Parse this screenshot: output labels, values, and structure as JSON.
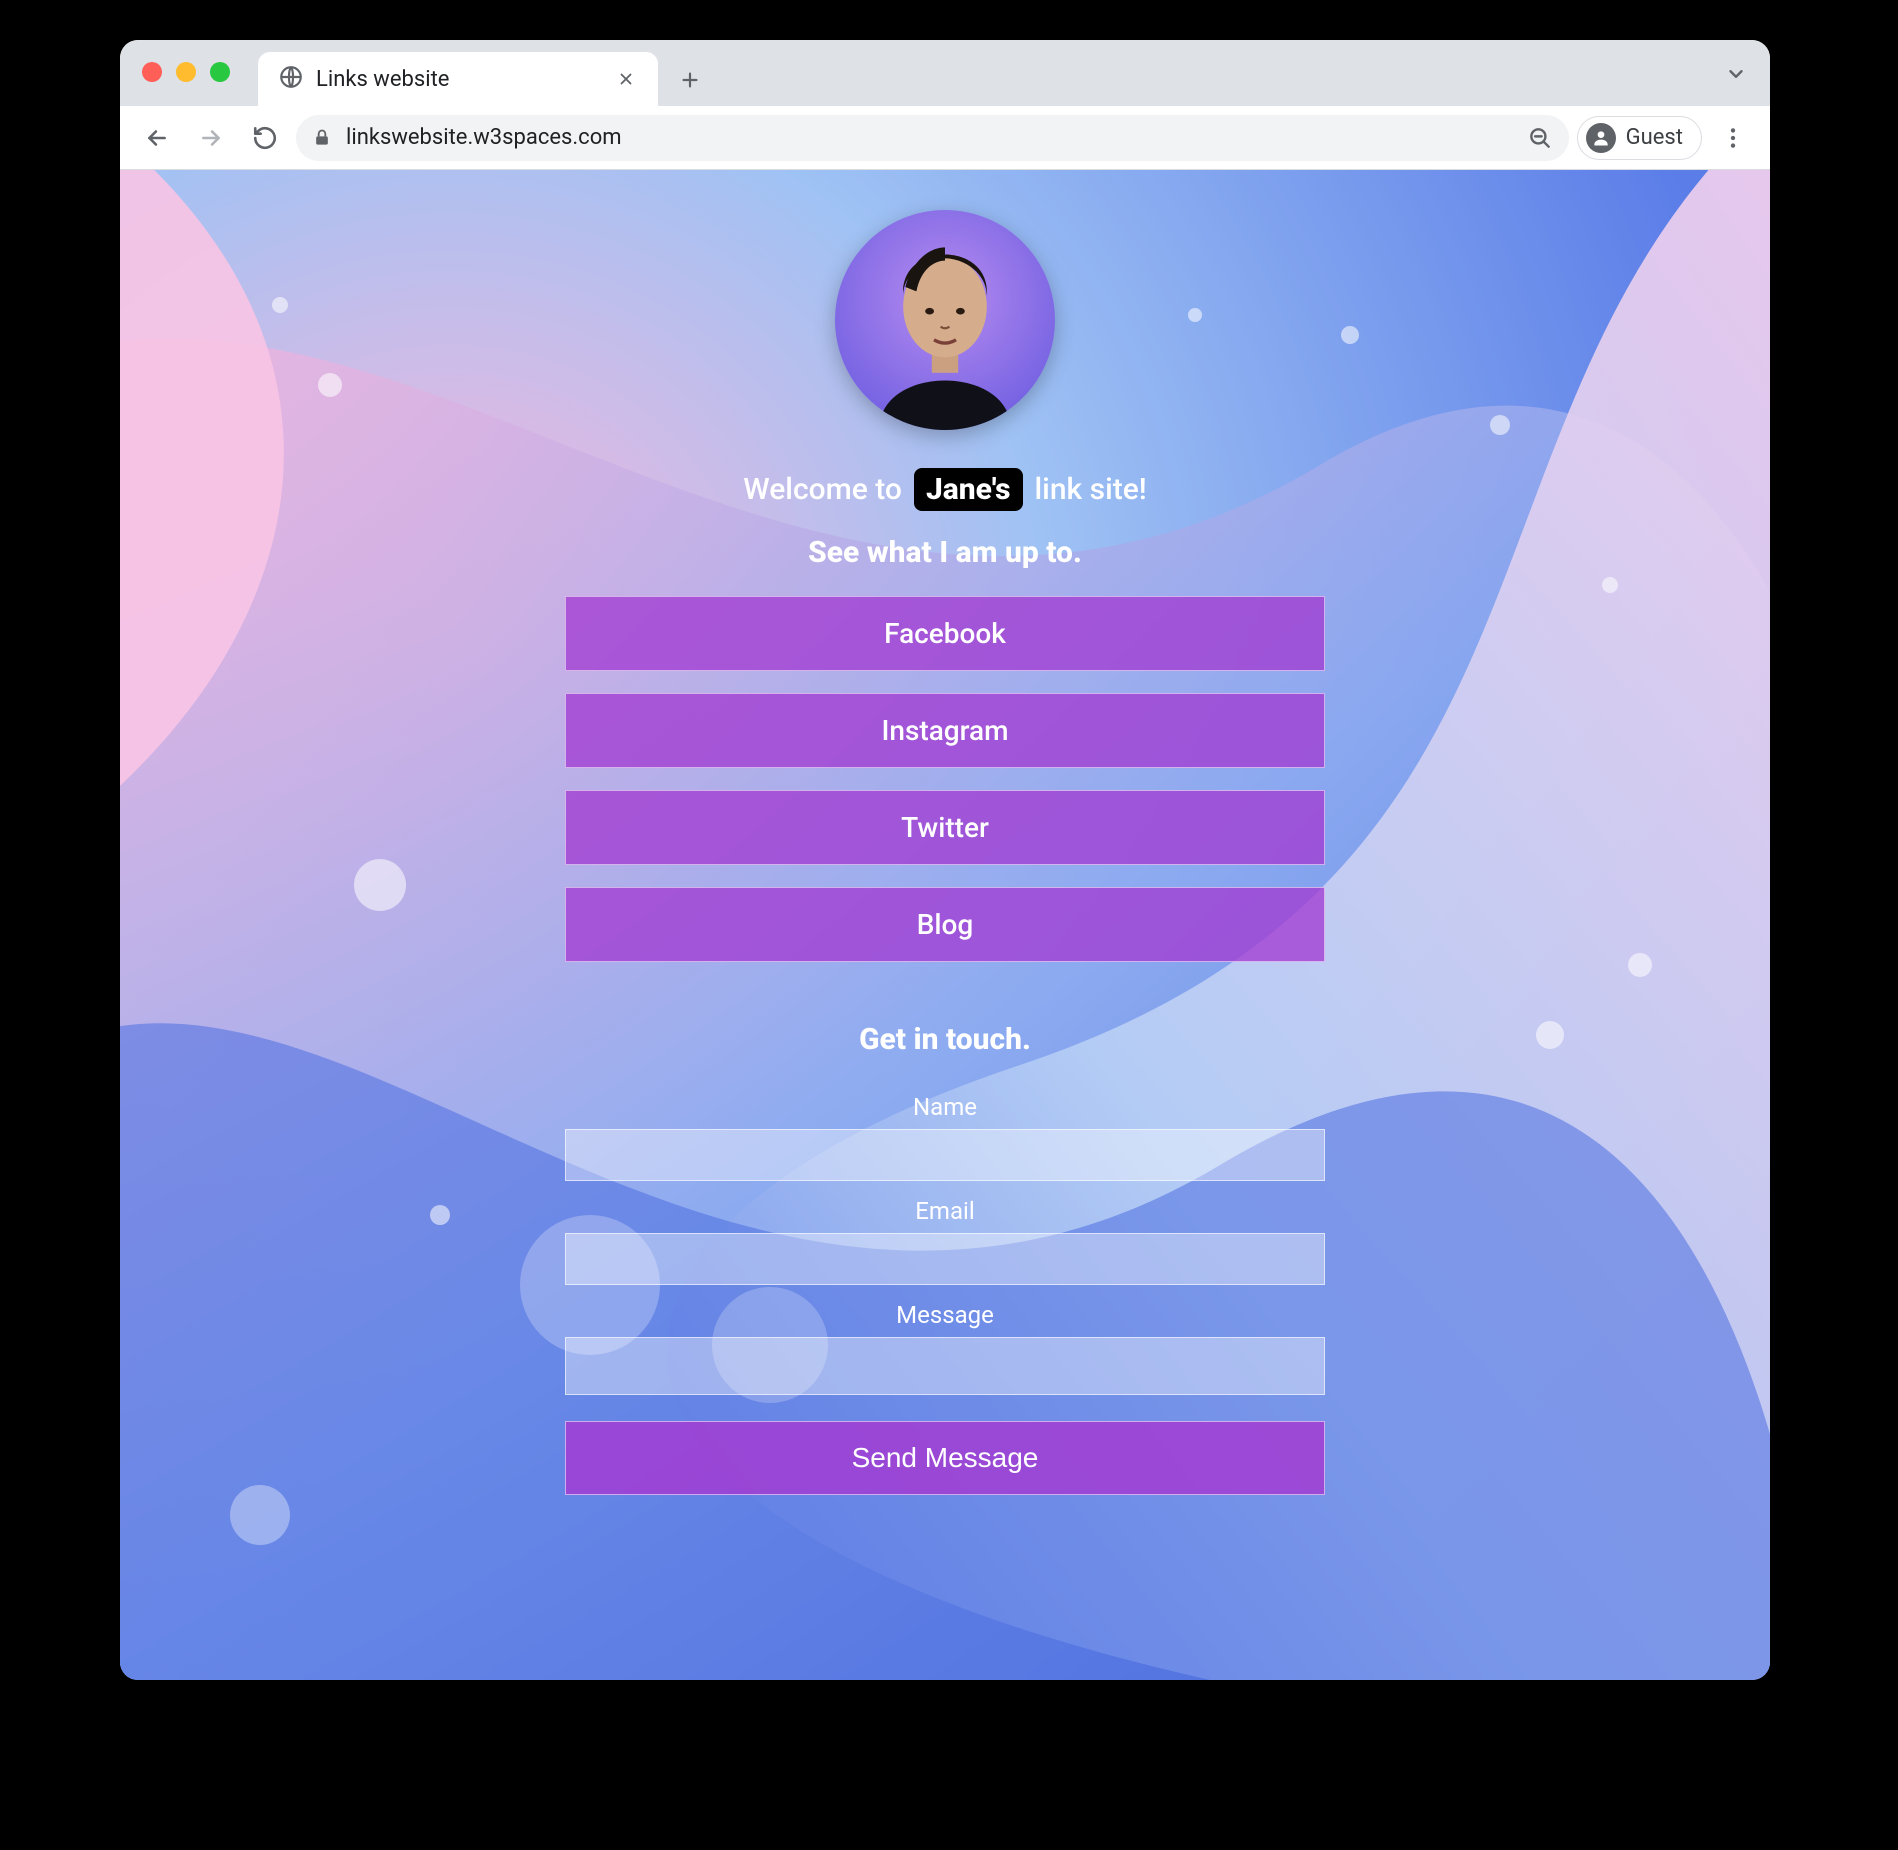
{
  "browser": {
    "tab_title": "Links website",
    "url": "linkswebsite.w3spaces.com",
    "guest_label": "Guest"
  },
  "profile": {
    "welcome_prefix": "Welcome to",
    "name": "Jane's",
    "welcome_suffix": "link site!",
    "subtitle": "See what I am up to."
  },
  "links": [
    {
      "label": "Facebook"
    },
    {
      "label": "Instagram"
    },
    {
      "label": "Twitter"
    },
    {
      "label": "Blog"
    }
  ],
  "contact": {
    "title": "Get in touch.",
    "fields": {
      "name_label": "Name",
      "email_label": "Email",
      "message_label": "Message"
    },
    "submit_label": "Send Message"
  },
  "colors": {
    "link_button": "#a23cd2",
    "bg_blue": "#5b7de8",
    "bg_pink": "#f7b6dd",
    "bg_light": "#cfe3f7"
  }
}
